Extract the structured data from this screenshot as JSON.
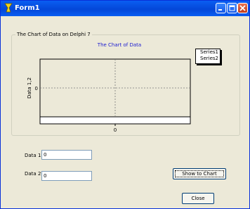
{
  "window": {
    "title": "Form1"
  },
  "group": {
    "label": "The Chart of Data on Delphi 7"
  },
  "chart_data": {
    "type": "line",
    "title": "The Chart of Data",
    "ylabel": "Data 1,2",
    "xlabel": "",
    "x_ticks": [
      "0"
    ],
    "y_ticks": [
      "0"
    ],
    "series": [
      {
        "name": "Series1",
        "values": []
      },
      {
        "name": "Series2",
        "values": []
      }
    ],
    "grid": true,
    "legend_position": "top-right"
  },
  "inputs": {
    "data1": {
      "label": "Data 1",
      "value": "0"
    },
    "data2": {
      "label": "Data 2",
      "value": "0"
    }
  },
  "buttons": {
    "show_chart": "Show to Chart",
    "close": "Close"
  }
}
